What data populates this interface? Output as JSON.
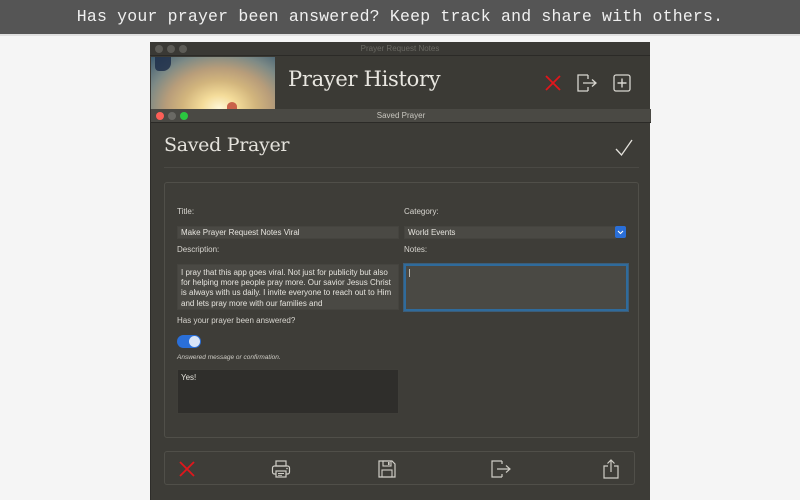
{
  "banner": {
    "text": "Has your prayer been answered? Keep track and share with others."
  },
  "back_window": {
    "title": "Prayer Request Notes",
    "heading": "Prayer History",
    "image": "sky-clouds-sunlight-image",
    "actions": [
      {
        "name": "delete",
        "icon": "close-icon",
        "color": "#e0161c"
      },
      {
        "name": "export",
        "icon": "export-icon"
      },
      {
        "name": "add",
        "icon": "add-square-icon"
      }
    ]
  },
  "front_window": {
    "title": "Saved Prayer",
    "heading": "Saved Prayer",
    "confirm_icon": "checkmark-icon",
    "form": {
      "title_label": "Title:",
      "title_value": "Make Prayer Request Notes Viral",
      "category_label": "Category:",
      "category_value": "World Events",
      "description_label": "Description:",
      "description_value": "I pray that this app goes viral. Not just for publicity but also for helping more people pray more. Our savior Jesus Christ is always with us daily. I invite everyone to reach out to Him and lets pray more with our families and",
      "notes_label": "Notes:",
      "notes_value": "",
      "answered_label": "Has your prayer been answered?",
      "answered_toggle": true,
      "answered_hint": "Answered message or confirmation.",
      "answered_message": "Yes!"
    },
    "toolbar": [
      {
        "name": "delete",
        "icon": "close-icon"
      },
      {
        "name": "print",
        "icon": "printer-icon"
      },
      {
        "name": "save",
        "icon": "floppy-disk-icon"
      },
      {
        "name": "export",
        "icon": "export-icon"
      },
      {
        "name": "share",
        "icon": "share-icon"
      }
    ]
  },
  "colors": {
    "accent_blue": "#2a6fd8",
    "danger_red": "#e0161c",
    "window_bg": "#3d3c37",
    "focus_ring": "#2f6b9c"
  }
}
